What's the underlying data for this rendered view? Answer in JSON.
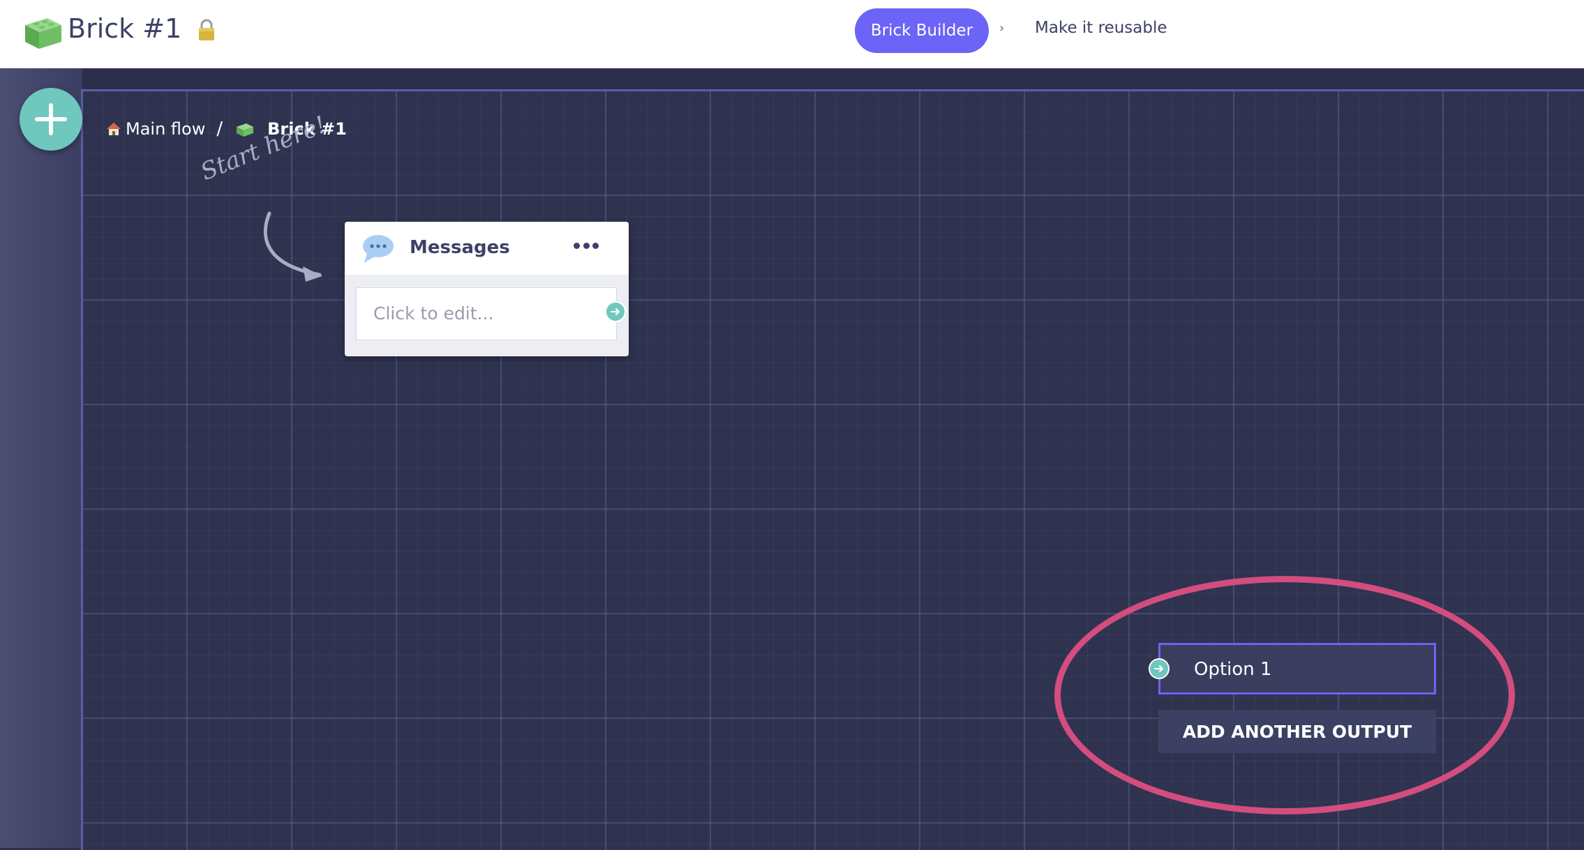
{
  "header": {
    "title": "Brick #1",
    "logo_icon": "lego-brick-icon",
    "lock_icon": "lock-icon",
    "steps": [
      {
        "label": "Brick Builder",
        "active": true
      },
      {
        "label": "Make it reusable",
        "active": false
      }
    ],
    "step_separator": "›"
  },
  "toolbar": {
    "add_button_icon": "plus-icon"
  },
  "breadcrumb": {
    "home_icon": "home-icon",
    "items": [
      "Main flow",
      "Brick #1"
    ],
    "separator": "/"
  },
  "canvas": {
    "hint_text": "Start here!",
    "message_node": {
      "title": "Messages",
      "icon": "chat-bubble-icon",
      "menu_icon": "more-horizontal-icon",
      "placeholder": "Click to edit..."
    },
    "outputs": {
      "items": [
        "Option 1"
      ],
      "add_label": "ADD ANOTHER OUTPUT",
      "highlight_color": "#d44d7f"
    }
  },
  "colors": {
    "accent": "#6c63f7",
    "port": "#6fc7bd",
    "canvas_bg": "#2f3350"
  }
}
